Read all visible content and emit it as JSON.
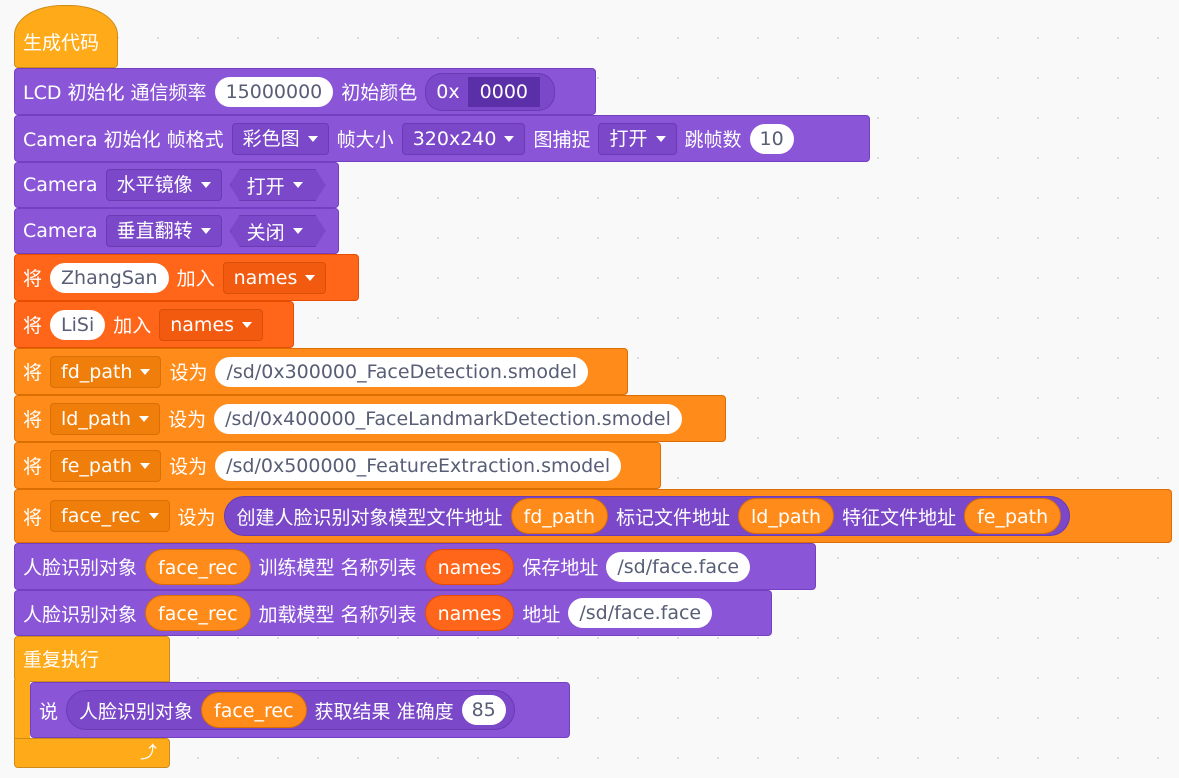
{
  "hat": {
    "label": "生成代码"
  },
  "lcd": {
    "title": "LCD 初始化 通信频率",
    "freq": "15000000",
    "color_label": "初始颜色",
    "color_prefix": "0x",
    "color_value": "0000"
  },
  "camera_init": {
    "title": "Camera 初始化 帧格式",
    "format": "彩色图",
    "size_label": "帧大小",
    "size": "320x240",
    "capture_label": "图捕捉",
    "capture": "打开",
    "skip_label": "跳帧数",
    "skip": "10"
  },
  "mirror": {
    "prefix": "Camera",
    "option": "水平镜像",
    "value": "打开"
  },
  "flip": {
    "prefix": "Camera",
    "option": "垂直翻转",
    "value": "关闭"
  },
  "add1": {
    "prefix": "将",
    "value": "ZhangSan",
    "mid": "加入",
    "list": "names"
  },
  "add2": {
    "prefix": "将",
    "value": "LiSi",
    "mid": "加入",
    "list": "names"
  },
  "set_fd": {
    "prefix": "将",
    "var": "fd_path",
    "mid": "设为",
    "value": "/sd/0x300000_FaceDetection.smodel"
  },
  "set_ld": {
    "prefix": "将",
    "var": "ld_path",
    "mid": "设为",
    "value": "/sd/0x400000_FaceLandmarkDetection.smodel"
  },
  "set_fe": {
    "prefix": "将",
    "var": "fe_path",
    "mid": "设为",
    "value": "/sd/0x500000_FeatureExtraction.smodel"
  },
  "set_rec": {
    "prefix": "将",
    "var": "face_rec",
    "mid": "设为",
    "r_label1": "创建人脸识别对象模型文件地址",
    "r_var1": "fd_path",
    "r_label2": "标记文件地址",
    "r_var2": "ld_path",
    "r_label3": "特征文件地址",
    "r_var3": "fe_path"
  },
  "train": {
    "label1": "人脸识别对象",
    "var": "face_rec",
    "label2": "训练模型 名称列表",
    "list": "names",
    "label3": "保存地址",
    "path": "/sd/face.face"
  },
  "load": {
    "label1": "人脸识别对象",
    "var": "face_rec",
    "label2": "加载模型 名称列表",
    "list": "names",
    "label3": "地址",
    "path": "/sd/face.face"
  },
  "loop": {
    "label": "重复执行",
    "icon": "loop-arrow-icon"
  },
  "say": {
    "prefix": "说",
    "r_label1": "人脸识别对象",
    "r_var": "face_rec",
    "r_label2": "获取结果 准确度",
    "value": "85"
  },
  "colors": {
    "motion": "#8a55d7",
    "data_list": "#ff661a",
    "data_var": "#ff8c1a",
    "control": "#ffab19"
  }
}
